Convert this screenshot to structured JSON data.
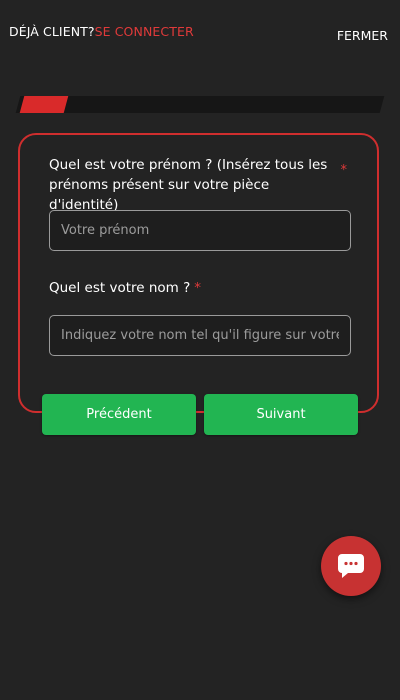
{
  "header": {
    "already_client": "DÉJÀ CLIENT?",
    "login_label": "SE CONNECTER",
    "close_label": "FERMER"
  },
  "progress": {
    "fraction": 0.12
  },
  "form": {
    "firstname": {
      "label": "Quel est votre prénom ? (Insérez tous les prénoms présent sur votre pièce d'identité)",
      "required_marker": "*",
      "placeholder": "Votre prénom",
      "value": ""
    },
    "lastname": {
      "label": "Quel est votre nom ?",
      "required_marker": "*",
      "placeholder": "Indiquez votre nom tel qu'il figure sur votre pièce d'identité",
      "value": ""
    }
  },
  "buttons": {
    "previous_label": "Précédent",
    "next_label": "Suivant"
  },
  "chat": {
    "icon": "chat-bubble-icon"
  },
  "colors": {
    "background": "#232323",
    "accent_red": "#d92a2a",
    "button_green": "#22b552"
  }
}
